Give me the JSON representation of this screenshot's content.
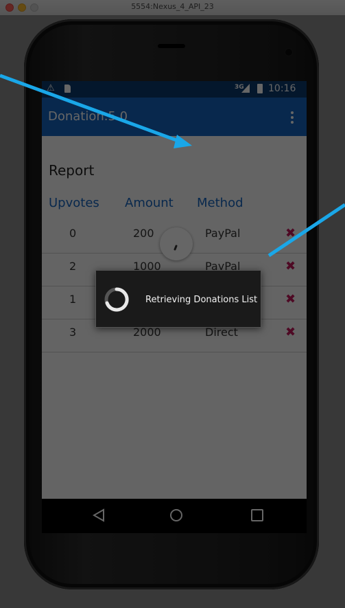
{
  "window": {
    "title": "5554:Nexus_4_API_23"
  },
  "status_bar": {
    "network": "3G",
    "time": "10:16",
    "warning_icon": "warning-icon",
    "sd_icon": "sdcard-icon"
  },
  "app_bar": {
    "title": "Donation.5.0"
  },
  "report": {
    "heading": "Report",
    "columns": [
      "Upvotes",
      "Amount",
      "Method"
    ],
    "rows": [
      {
        "upvotes": "0",
        "amount": "200",
        "method": "PayPal"
      },
      {
        "upvotes": "2",
        "amount": "1000",
        "method": "PayPal"
      },
      {
        "upvotes": "1",
        "amount": "",
        "method": ""
      },
      {
        "upvotes": "3",
        "amount": "2000",
        "method": "Direct"
      }
    ]
  },
  "dialog": {
    "message": "Retrieving Donations List"
  },
  "nav_bar": {
    "back": "back-icon",
    "home": "home-icon",
    "recents": "recents-icon"
  },
  "colors": {
    "primary": "#1565c0",
    "status_bar": "#0b3a6e",
    "delete": "#c2185b",
    "arrow": "#1aa7e8"
  }
}
